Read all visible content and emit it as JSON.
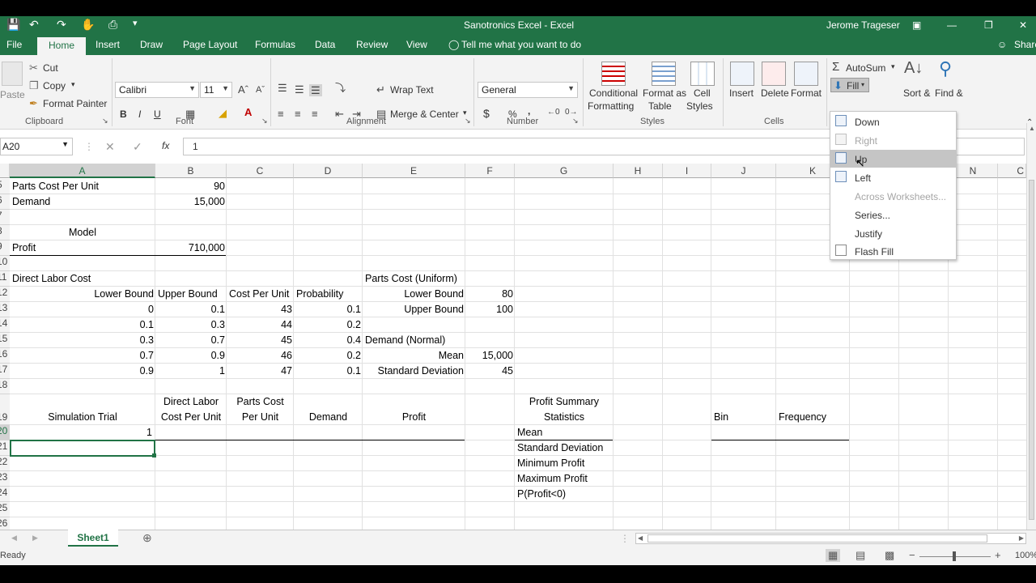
{
  "window": {
    "title": "Sanotronics Excel  -  Excel",
    "user": "Jerome Trageser",
    "share": "Share",
    "brand_color": "#217346"
  },
  "tabs": [
    "File",
    "Home",
    "Insert",
    "Draw",
    "Page Layout",
    "Formulas",
    "Data",
    "Review",
    "View"
  ],
  "tell_me": "Tell me what you want to do",
  "ribbon": {
    "clipboard": {
      "paste": "Paste",
      "cut": "Cut",
      "copy": "Copy",
      "format_painter": "Format Painter",
      "group": "Clipboard"
    },
    "font": {
      "name": "Calibri",
      "size": "11",
      "bold": "B",
      "italic": "I",
      "underline": "U",
      "group": "Font"
    },
    "alignment": {
      "wrap": "Wrap Text",
      "merge": "Merge & Center",
      "group": "Alignment"
    },
    "number": {
      "format": "General",
      "currency": "$",
      "percent": "%",
      "comma": ",",
      "group": "Number"
    },
    "styles": {
      "conditional_1": "Conditional",
      "conditional_2": "Formatting",
      "format_table_1": "Format as",
      "format_table_2": "Table",
      "cell_styles_1": "Cell",
      "cell_styles_2": "Styles",
      "group": "Styles"
    },
    "cells": {
      "insert": "Insert",
      "delete": "Delete",
      "format": "Format",
      "group": "Cells"
    },
    "editing": {
      "autosum": "AutoSum",
      "fill": "Fill",
      "sort": "Sort &",
      "find": "Find &"
    }
  },
  "fill_menu": [
    {
      "label": "Down",
      "enabled": true
    },
    {
      "label": "Right",
      "enabled": false
    },
    {
      "label": "Up",
      "enabled": true
    },
    {
      "label": "Left",
      "enabled": true
    },
    {
      "label": "Across Worksheets...",
      "enabled": false
    },
    {
      "label": "Series...",
      "enabled": true
    },
    {
      "label": "Justify",
      "enabled": true
    },
    {
      "label": "Flash Fill",
      "enabled": true
    }
  ],
  "formula_bar": {
    "name_box": "A20",
    "formula": "1",
    "fx": "fx"
  },
  "columns": [
    "A",
    "B",
    "C",
    "D",
    "E",
    "F",
    "G",
    "H",
    "I",
    "J",
    "K",
    "L",
    "M",
    "N",
    "C"
  ],
  "rows": [
    "5",
    "6",
    "7",
    "8",
    "9",
    "10",
    "11",
    "12",
    "13",
    "14",
    "15",
    "16",
    "17",
    "18",
    "19",
    "20",
    "21",
    "22",
    "23",
    "24",
    "25",
    "26"
  ],
  "cells": {
    "a5": "Parts Cost Per Unit",
    "b5": "90",
    "a6": "Demand",
    "b6": "15,000",
    "a8": "Model",
    "a9": "Profit",
    "b9": "710,000",
    "a11": "Direct Labor Cost",
    "e11": "Parts Cost (Uniform)",
    "a12": "Lower Bound",
    "b12": "Upper Bound",
    "c12": "Cost Per Unit",
    "d12": "Probability",
    "e12": "Lower Bound",
    "f12": "80",
    "a13": "0",
    "b13": "0.1",
    "c13": "43",
    "d13": "0.1",
    "e13": "Upper Bound",
    "f13": "100",
    "a14": "0.1",
    "b14": "0.3",
    "c14": "44",
    "d14": "0.2",
    "a15": "0.3",
    "b15": "0.7",
    "c15": "45",
    "d15": "0.4",
    "e15": "Demand (Normal)",
    "a16": "0.7",
    "b16": "0.9",
    "c16": "46",
    "d16": "0.2",
    "e16": "Mean",
    "f16": "15,000",
    "a17": "0.9",
    "b17": "1",
    "c17": "47",
    "d17": "0.1",
    "e17": "Standard Deviation",
    "f17": "45",
    "b18": "Direct Labor",
    "c18": "Parts Cost",
    "g18": "Profit Summary",
    "a19": "Simulation Trial",
    "b19": "Cost Per Unit",
    "c19": "Per Unit",
    "d19": "Demand",
    "e19": "Profit",
    "g19": "Statistics",
    "j19": "Bin",
    "k19": "Frequency",
    "a20": "1",
    "g20": "Mean",
    "g21": "Standard Deviation",
    "g22": "Minimum Profit",
    "g23": "Maximum Profit",
    "g24": "P(Profit<0)"
  },
  "sheet_tab": "Sheet1",
  "status": {
    "ready": "Ready",
    "zoom": "100%"
  }
}
